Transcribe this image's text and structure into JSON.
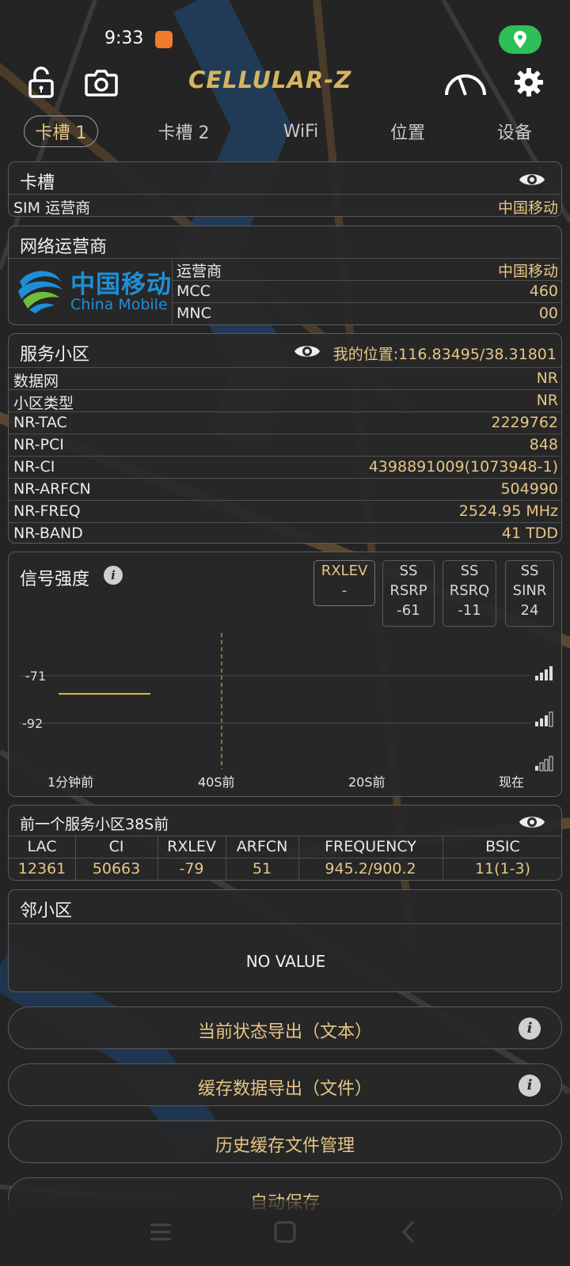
{
  "colors": {
    "accent": "#e7c585",
    "status_green": "#2fbf57",
    "map_road": "#5a4631"
  },
  "status_bar": {
    "time": "9:33",
    "icons": [
      "app-notification-icon",
      "location-pill-icon"
    ]
  },
  "toolbar": {
    "logo": "CELLULAR-Z",
    "icons": [
      "unlock-icon",
      "camera-icon",
      "speedometer-icon",
      "gear-icon"
    ]
  },
  "tabs": [
    {
      "label": "卡槽 1",
      "active": true
    },
    {
      "label": "卡槽 2",
      "active": false
    },
    {
      "label": "WiFi",
      "active": false
    },
    {
      "label": "位置",
      "active": false
    },
    {
      "label": "设备",
      "active": false
    }
  ],
  "slot_panel": {
    "title": "卡槽",
    "rows": [
      {
        "key": "SIM 运营商",
        "value": "中国移动"
      }
    ]
  },
  "operator_panel": {
    "title": "网络运营商",
    "logo_cn": "中国移动",
    "logo_en": "China Mobile",
    "rows": [
      {
        "key": "运营商",
        "value": "中国移动"
      },
      {
        "key": "MCC",
        "value": "460"
      },
      {
        "key": "MNC",
        "value": "00"
      }
    ]
  },
  "cell_panel": {
    "title": "服务小区",
    "location": "我的位置:116.83495/38.31801",
    "rows": [
      {
        "key": "数据网",
        "value": "NR"
      },
      {
        "key": "小区类型",
        "value": "NR"
      },
      {
        "key": "NR-TAC",
        "value": "2229762"
      },
      {
        "key": "NR-PCI",
        "value": "848"
      },
      {
        "key": "NR-CI",
        "value": "4398891009(1073948-1)"
      },
      {
        "key": "NR-ARFCN",
        "value": "504990"
      },
      {
        "key": "NR-FREQ",
        "value": "2524.95 MHz"
      },
      {
        "key": "NR-BAND",
        "value": "41 TDD"
      }
    ]
  },
  "signal_panel": {
    "title": "信号强度",
    "boxes": [
      {
        "line1": "RXLEV",
        "line2": "",
        "value": "-",
        "active": true
      },
      {
        "line1": "SS",
        "line2": "RSRP",
        "value": "-61",
        "active": false
      },
      {
        "line1": "SS",
        "line2": "RSRQ",
        "value": "-11",
        "active": false
      },
      {
        "line1": "SS",
        "line2": "SINR",
        "value": "24",
        "active": false
      }
    ]
  },
  "chart_data": {
    "type": "line",
    "y_ticks": [
      "-71",
      "-92"
    ],
    "x_ticks": [
      "1分钟前",
      "40S前",
      "20S前",
      "现在"
    ],
    "series": [
      {
        "x": [
          60,
          48
        ],
        "y": [
          -79,
          -79
        ]
      }
    ]
  },
  "prev_cell_panel": {
    "title": "前一个服务小区38S前",
    "headers": [
      "LAC",
      "CI",
      "RXLEV",
      "ARFCN",
      "FREQUENCY",
      "BSIC"
    ],
    "values": [
      "12361",
      "50663",
      "-79",
      "51",
      "945.2/900.2",
      "11(1-3)"
    ]
  },
  "neighbor_panel": {
    "title": "邻小区",
    "empty_text": "NO VALUE"
  },
  "buttons": [
    {
      "label": "当前状态导出（文本）",
      "info": "i"
    },
    {
      "label": "缓存数据导出（文件）",
      "info": "i"
    },
    {
      "label": "历史缓存文件管理"
    },
    {
      "label": "自动保存"
    }
  ],
  "nav_bar": {
    "icons": [
      "menu-icon",
      "home-icon",
      "back-icon"
    ]
  }
}
